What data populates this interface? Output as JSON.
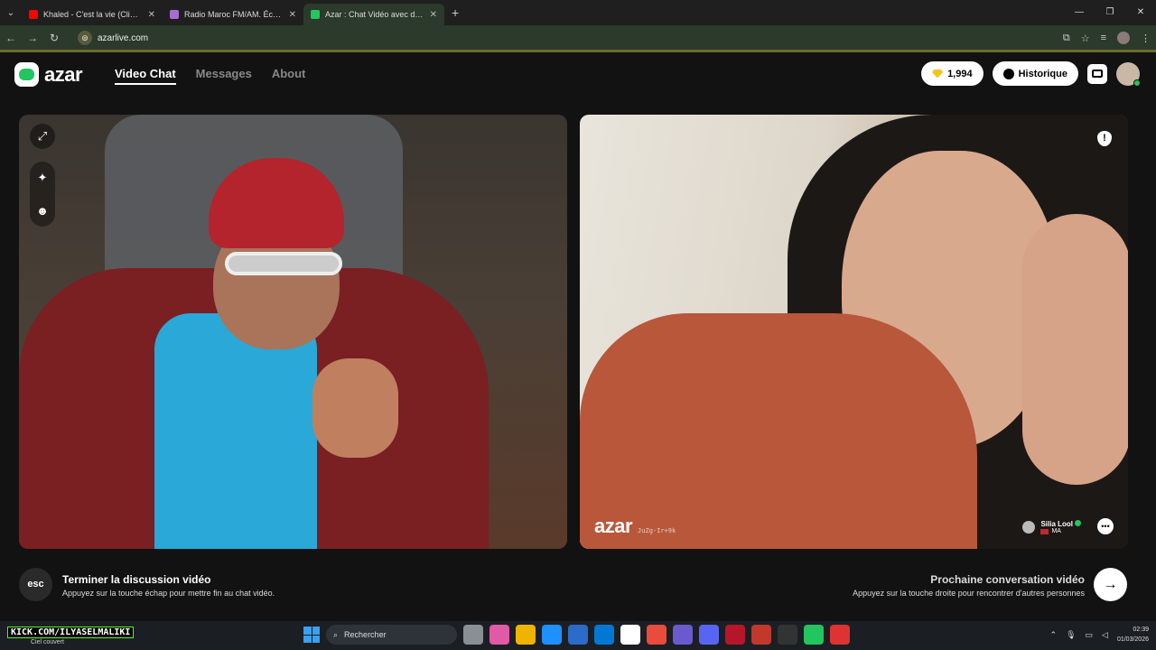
{
  "browser": {
    "tabs": [
      {
        "label": "Khaled - C'est la vie (Clip officie",
        "color": "#ff0000",
        "active": false
      },
      {
        "label": "Radio Maroc FM/AM. Écouter r",
        "color": "#a86bd6",
        "active": false
      },
      {
        "label": "Azar : Chat Vidéo avec de n",
        "color": "#22c55e",
        "active": true
      }
    ],
    "url": "azarlive.com",
    "new_tab": "+",
    "menu_glyph": "⌄"
  },
  "app": {
    "logo_text": "azar",
    "nav": [
      {
        "label": "Video Chat",
        "active": true
      },
      {
        "label": "Messages",
        "active": false
      },
      {
        "label": "About",
        "active": false
      }
    ],
    "gems": "1,994",
    "history_label": "Historique"
  },
  "remote": {
    "watermark": "azar",
    "session_id": "JuZg-Ir+9k",
    "peer_name": "Silia Lool",
    "peer_country": "MA",
    "report_glyph": "!"
  },
  "footer": {
    "esc_label": "esc",
    "end_title": "Terminer la discussion vidéo",
    "end_sub": "Appuyez sur la touche échap pour mettre fin au chat vidéo.",
    "next_title": "Prochaine conversation vidéo",
    "next_sub": "Appuyez sur la touche droite pour rencontrer d'autres personnes",
    "next_glyph": "→"
  },
  "taskbar": {
    "kick": "KICK.COM/ILYASELMALIKI",
    "weather": "Ciel couvert",
    "search_placeholder": "Rechercher",
    "time": "02:39",
    "date": "01/03/2026",
    "app_colors": [
      "#8a8f96",
      "#e05aa6",
      "#f0b400",
      "#1e90ff",
      "#2a6cc8",
      "#0078d4",
      "#ffffff",
      "#e74c3c",
      "#6a5acd",
      "#5865f2",
      "#b5162b",
      "#c0392b",
      "#333333",
      "#22c55e",
      "#d33"
    ]
  },
  "colors": {
    "accent": "#22c55e",
    "background": "#121212"
  }
}
